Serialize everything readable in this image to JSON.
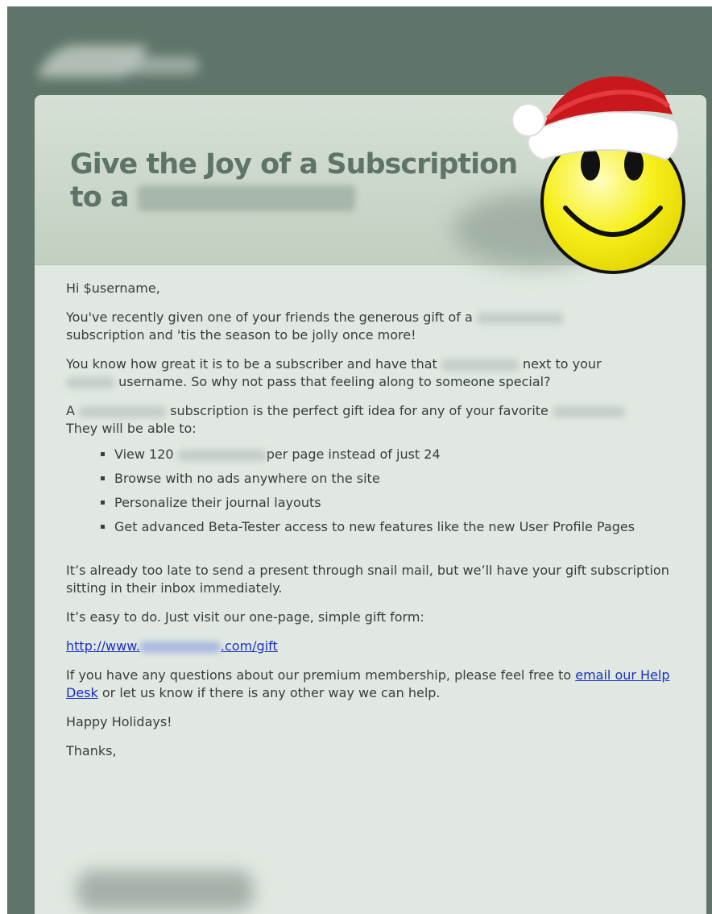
{
  "email": {
    "title_line1": "Give the Joy of a Subscription",
    "title_line2_prefix": "to a",
    "greeting": "Hi $username,",
    "p1a": "You've recently given one of your friends the generous gift of a",
    "p1b": "subscription and 'tis the season to be jolly once more!",
    "p2a": "You know how great it is to be a subscriber and have that",
    "p2b": "next to your",
    "p2c": "username. So why not pass that feeling along to someone special?",
    "p3a": "A",
    "p3b": "subscription is the perfect gift idea for any of your favorite",
    "p3c": "They will be able to:",
    "bullets": {
      "b1a": "View 120",
      "b1b": "per page instead of just 24",
      "b2": "Browse with no ads anywhere on the site",
      "b3": "Personalize their journal layouts",
      "b4": "Get advanced Beta-Tester access to new features like the new User Profile Pages"
    },
    "p4": "It’s already too late to send a present through snail mail, but we’ll have your gift subscription sitting in their inbox immediately.",
    "p5": "It’s easy to do. Just visit our one-page, simple gift form:",
    "link_prefix": "http://www.",
    "link_suffix": ".com/gift",
    "p6a": "If you have any questions about our premium membership, please feel free to",
    "p6_link": "email our Help Desk",
    "p6b": "or let us know if there is any other way we can help.",
    "p7": "Happy Holidays!",
    "p8": "Thanks,"
  },
  "colors": {
    "frame": "#5f7569",
    "card": "#e0e8e1",
    "title": "#5e7468",
    "link": "#1b2fc4",
    "smiley": "#f4ee1a",
    "hat": "#c8181c"
  },
  "icons": {
    "logo": "blurred-logo-icon",
    "smiley": "santa-smiley-icon"
  }
}
